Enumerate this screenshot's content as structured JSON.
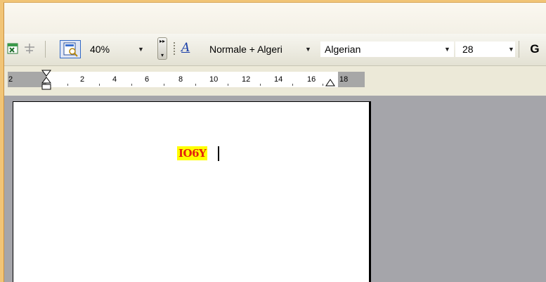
{
  "toolbar": {
    "zoom": "40%",
    "style": "Normale + Algeri",
    "font": "Algerian",
    "font_size": "28",
    "bold_label": "G",
    "style_icon_label": "A"
  },
  "ruler": {
    "left_label": "2",
    "labels": [
      "2",
      "4",
      "6",
      "8",
      "10",
      "12",
      "14",
      "16",
      "18"
    ]
  },
  "document": {
    "text": "IO6Y"
  },
  "colors": {
    "highlight": "#ffff00",
    "text_color": "#e3220d",
    "editor_bg": "#a5a5aa"
  }
}
